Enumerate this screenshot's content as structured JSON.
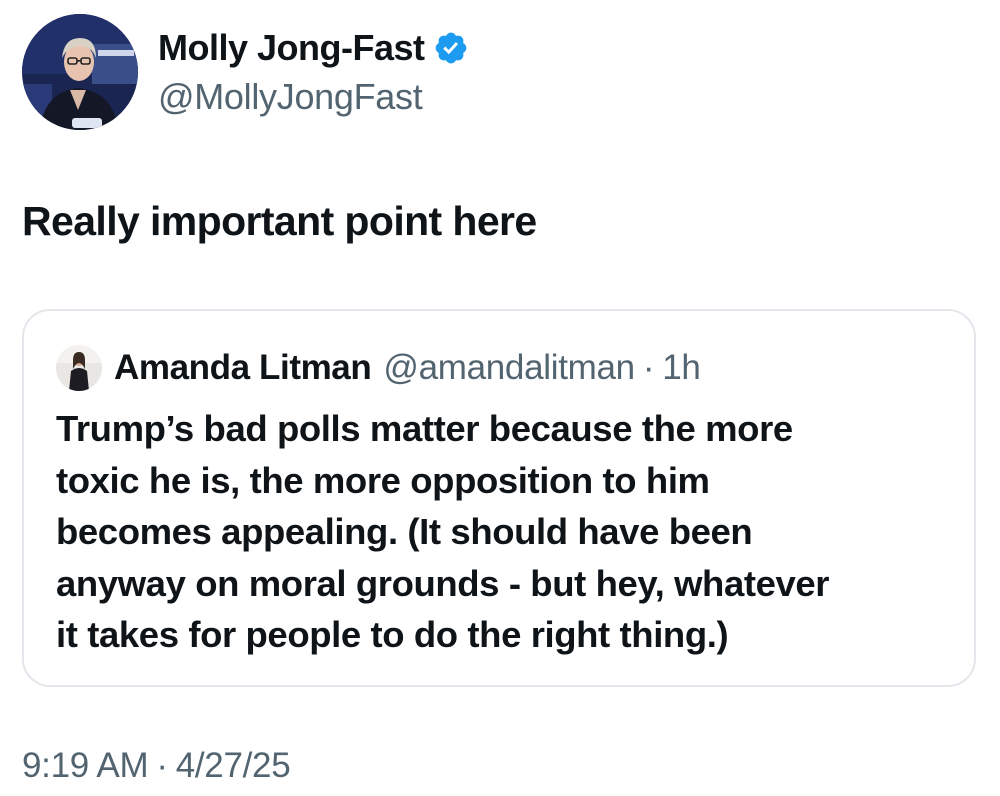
{
  "author": {
    "display_name": "Molly Jong-Fast",
    "handle": "@MollyJongFast",
    "verified": true,
    "verified_color": "#1d9bf0"
  },
  "tweet": {
    "text": "Really important point here"
  },
  "quoted_tweet": {
    "author_name": "Amanda Litman",
    "author_handle": "@amandalitman",
    "separator": "·",
    "relative_time": "1h",
    "lines": [
      "Trump’s bad polls matter because the more",
      "toxic he is, the more opposition to him",
      "becomes appealing. (It should have been",
      "anyway on moral grounds - but hey, whatever",
      "it takes for people to do the right thing.)"
    ]
  },
  "meta": {
    "time": "9:19 AM",
    "separator": "·",
    "date": "4/27/25"
  },
  "colors": {
    "text_primary": "#0f1419",
    "text_secondary": "#536471",
    "border": "#e3e6ea"
  }
}
